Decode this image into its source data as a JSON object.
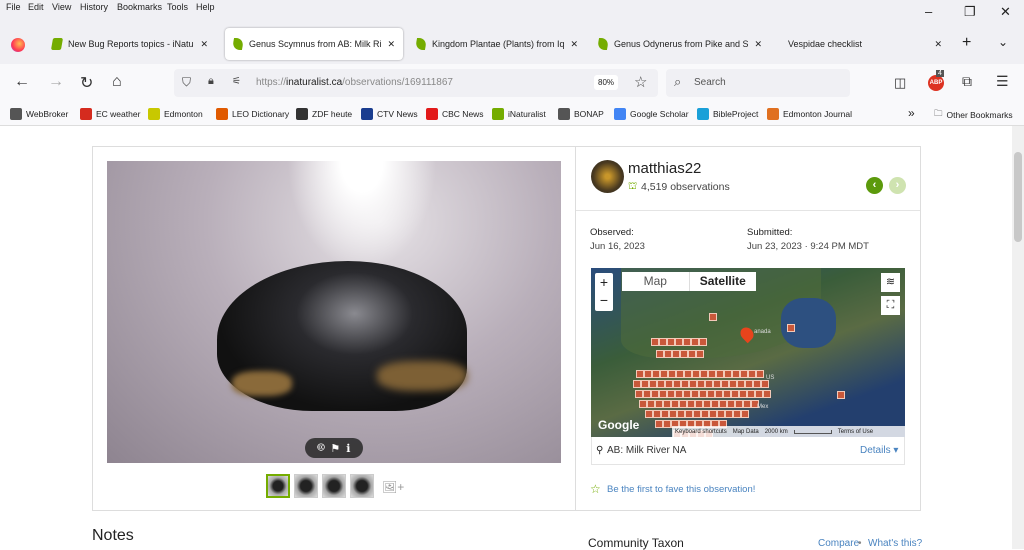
{
  "menu": [
    "File",
    "Edit",
    "View",
    "History",
    "Bookmarks",
    "Tools",
    "Help"
  ],
  "tabs": [
    {
      "title": "New Bug Reports topics - iNaturalist"
    },
    {
      "title": "Genus Scymnus from AB: Milk River"
    },
    {
      "title": "Kingdom Plantae (Plants) from Iqalu"
    },
    {
      "title": "Genus Odynerus from Pike and San"
    },
    {
      "title": "Vespidae checklist"
    }
  ],
  "url": {
    "prefix": "https://",
    "domain": "inaturalist.ca",
    "path": "/observations/169111867",
    "zoom": "80%"
  },
  "search_placeholder": "Search",
  "abp_badge": "4",
  "bookmarks": [
    {
      "label": "WebBroker",
      "color": "#555"
    },
    {
      "label": "EC weather",
      "color": "#d52b1e"
    },
    {
      "label": "Edmonton",
      "color": "#c8c800"
    },
    {
      "label": "LEO Dictionary",
      "color": "#e05a00"
    },
    {
      "label": "ZDF heute",
      "color": "#333"
    },
    {
      "label": "CTV News",
      "color": "#1a3d8f"
    },
    {
      "label": "CBC News",
      "color": "#e21a1a"
    },
    {
      "label": "iNaturalist",
      "color": "#74ac00"
    },
    {
      "label": "BONAP",
      "color": "#555"
    },
    {
      "label": "Google Scholar",
      "color": "#4285f4"
    },
    {
      "label": "BibleProject",
      "color": "#1aa0d8"
    },
    {
      "label": "Edmonton Journal",
      "color": "#e07020"
    }
  ],
  "other_bookmarks": "Other Bookmarks",
  "observation": {
    "user": "matthias22",
    "obs_count": "4,519 observations",
    "observed_label": "Observed:",
    "observed_date": "Jun 16, 2023",
    "submitted_label": "Submitted:",
    "submitted_date": "Jun 23, 2023 · 9:24 PM MDT",
    "map": {
      "tab_map": "Map",
      "tab_satellite": "Satellite",
      "google": "Google",
      "keyboard": "Keyboard shortcuts",
      "map_data": "Map Data",
      "scale": "2000 km",
      "terms": "Terms of Use",
      "label_canada": "anada",
      "label_us": "US",
      "label_mexico": "Mex"
    },
    "location": "AB: Milk River NA",
    "details": "Details ▾",
    "fave": "Be the first to fave this observation!",
    "notes": "Notes",
    "community_taxon": "Community Taxon",
    "compare": "Compare",
    "whats_this": "What's this?"
  },
  "accent": "#74ac00"
}
